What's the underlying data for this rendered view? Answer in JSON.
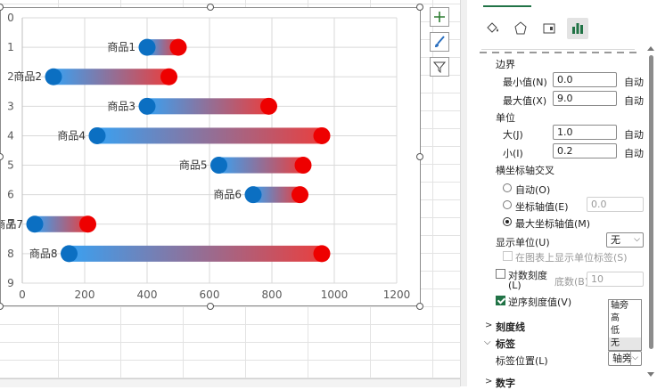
{
  "chart_data": {
    "type": "bar",
    "subtype": "floating-range (dumbbell), horizontal",
    "categories": [
      "商品1",
      "商品2",
      "商品3",
      "商品4",
      "商品5",
      "商品6",
      "商品7",
      "商品8"
    ],
    "y_positions": [
      1,
      2,
      3,
      4,
      5,
      6,
      7,
      8
    ],
    "series": [
      {
        "name": "",
        "values": [
          400,
          100,
          400,
          240,
          630,
          740,
          40,
          150
        ]
      },
      {
        "name": "",
        "values": [
          500,
          470,
          790,
          960,
          900,
          890,
          210,
          960
        ]
      }
    ],
    "xlim": [
      0,
      1200
    ],
    "ylim": [
      0,
      9
    ],
    "x_ticks": [
      "0",
      "200",
      "400",
      "600",
      "800",
      "1000",
      "1200"
    ],
    "y_ticks": [
      "0",
      "1",
      "2",
      "3",
      "4",
      "5",
      "6",
      "7",
      "8",
      "9"
    ],
    "y_reversed": true,
    "grid": true,
    "colors": {
      "start": "#0b6fc2",
      "end": "#ee0000",
      "gradient_start": "#3aa0f0",
      "gradient_end": "#e84040"
    },
    "title": "",
    "xlabel": "",
    "ylabel": ""
  },
  "chart_tools": [
    {
      "icon": "plus-icon",
      "name": "chart-elements-button"
    },
    {
      "icon": "brush-icon",
      "name": "chart-styles-button"
    },
    {
      "icon": "filter-icon",
      "name": "chart-filters-button"
    }
  ],
  "panel": {
    "format_icons": [
      "fill-line-icon",
      "effects-icon",
      "size-properties-icon",
      "axis-options-icon"
    ],
    "bounds_heading": "边界",
    "min_label": "最小值(N)",
    "min_value": "0.0",
    "min_auto": "自动",
    "max_label": "最大值(X)",
    "max_value": "9.0",
    "max_auto": "自动",
    "units_heading": "单位",
    "major_label": "大(J)",
    "major_value": "1.0",
    "major_auto": "自动",
    "minor_label": "小(I)",
    "minor_value": "0.2",
    "minor_auto": "自动",
    "crosses_heading": "横坐标轴交叉",
    "crosses_auto": "自动(O)",
    "crosses_value_label": "坐标轴值(E)",
    "crosses_value": "0.0",
    "crosses_max": "最大坐标轴值(M)",
    "display_units_label": "显示单位(U)",
    "display_units_value": "无",
    "show_units_label": "在图表上显示单位标签(S)",
    "log_scale_label": "对数刻度",
    "log_scale_label2": "(L)",
    "base_label": "底数(B)",
    "base_value": "10",
    "reverse_label": "逆序刻度值(V)",
    "tick_marks_section": "刻度线",
    "labels_section": "标签",
    "label_position_label": "标签位置(L)",
    "label_position_value": "轴旁",
    "label_position_options": [
      "轴旁",
      "高",
      "低",
      "无"
    ],
    "number_section": "数字"
  }
}
